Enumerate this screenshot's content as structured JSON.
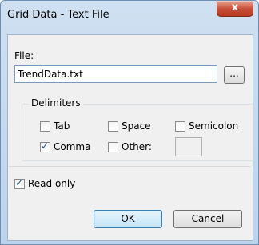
{
  "window": {
    "title": "Grid Data - Text File",
    "close_glyph": "x"
  },
  "file": {
    "label": "File:",
    "value": "TrendData.txt",
    "browse_label": "..."
  },
  "delimiters": {
    "group_label": "Delimiters",
    "tab": {
      "label": "Tab",
      "checked": false
    },
    "space": {
      "label": "Space",
      "checked": false
    },
    "semicolon": {
      "label": "Semicolon",
      "checked": false
    },
    "comma": {
      "label": "Comma",
      "checked": true
    },
    "other": {
      "label": "Other:",
      "checked": false,
      "value": ""
    }
  },
  "read_only": {
    "label": "Read only",
    "checked": true
  },
  "buttons": {
    "ok": "OK",
    "cancel": "Cancel"
  },
  "colors": {
    "accent": "#3c7fb1",
    "close": "#c74c36",
    "frame": "#bcd3eb"
  }
}
